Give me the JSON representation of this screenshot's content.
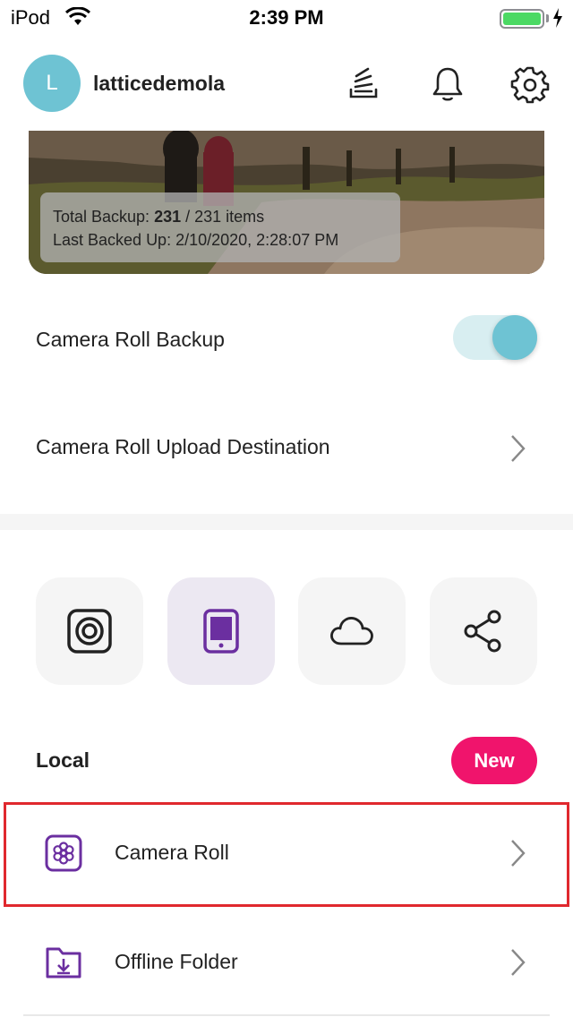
{
  "status_bar": {
    "carrier": "iPod",
    "time": "2:39 PM",
    "battery_level": 1.0
  },
  "header": {
    "avatar_initial": "L",
    "username": "latticedemola",
    "icons": [
      "layers-icon",
      "bell-icon",
      "gear-icon"
    ]
  },
  "banner": {
    "total_prefix": "Total Backup: ",
    "total_count": "231",
    "total_suffix": " / 231 items",
    "last_backed_up": "Last Backed Up: 2/10/2020, 2:28:07 PM"
  },
  "settings": {
    "camera_roll_backup_label": "Camera Roll Backup",
    "camera_roll_backup_enabled": true,
    "upload_destination_label": "Camera Roll Upload Destination"
  },
  "sources": {
    "tiles": [
      "camera-icon",
      "tablet-icon",
      "cloud-icon",
      "share-icon"
    ],
    "active": "tablet-icon"
  },
  "local": {
    "title": "Local",
    "badge": "New",
    "items": [
      {
        "label": "Camera Roll",
        "icon": "flower-icon"
      },
      {
        "label": "Offline Folder",
        "icon": "download-folder-icon"
      }
    ]
  },
  "colors": {
    "accent_teal": "#6ec3d3",
    "accent_purple": "#6b2fa0",
    "badge_pink": "#f0146c",
    "highlight_red": "#e0282e"
  }
}
